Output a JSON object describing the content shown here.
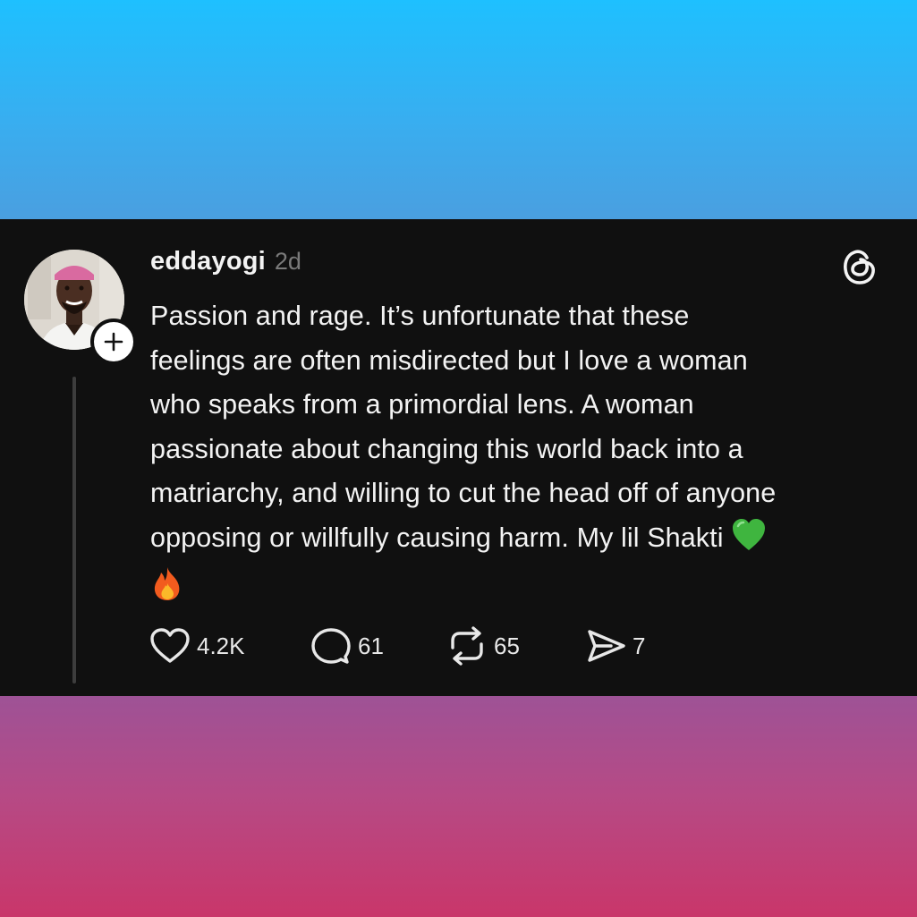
{
  "post": {
    "username": "eddayogi",
    "time": "2d",
    "lines": [
      "Passion and rage. It’s unfortunate that these",
      "feelings are often misdirected but I love a woman",
      "who speaks from a primordial lens. A woman",
      "passionate about changing this world back into a",
      "matriarchy, and willing to cut the head off of anyone",
      "opposing or willfully causing harm. My lil Shakti"
    ],
    "emojis": [
      "green-heart-emoji",
      "fire-emoji"
    ]
  },
  "actions": {
    "likes": "4.2K",
    "replies": "61",
    "reposts": "65",
    "shares": "7"
  },
  "colors": {
    "card_background": "#101010",
    "text": "#f3f3f3",
    "muted": "#7a7a7a",
    "top_gradient": [
      "#1ec0ff",
      "#4a9fe0"
    ],
    "bottom_gradient": [
      "#9e5296",
      "#c9366a"
    ]
  },
  "icons": [
    "plus-icon",
    "threads-logo-icon",
    "heart-icon",
    "comment-icon",
    "repost-icon",
    "share-icon"
  ]
}
